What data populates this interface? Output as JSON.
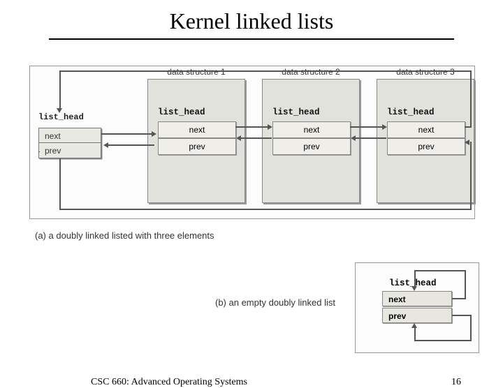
{
  "title": "Kernel linked lists",
  "diagramA": {
    "sentinel": {
      "label": "list_head",
      "next": "next",
      "prev": "prev"
    },
    "structs": [
      {
        "title": "data structure 1",
        "header": "list_head",
        "next": "next",
        "prev": "prev"
      },
      {
        "title": "data structure 2",
        "header": "list_head",
        "next": "next",
        "prev": "prev"
      },
      {
        "title": "data structure 3",
        "header": "list_head",
        "next": "next",
        "prev": "prev"
      }
    ],
    "caption": "(a)  a doubly linked listed with three elements"
  },
  "diagramB": {
    "caption": "(b)  an empty doubly linked list",
    "header": "list_head",
    "next": "next",
    "prev": "prev"
  },
  "footer": {
    "course": "CSC 660: Advanced Operating Systems",
    "page": "16"
  }
}
